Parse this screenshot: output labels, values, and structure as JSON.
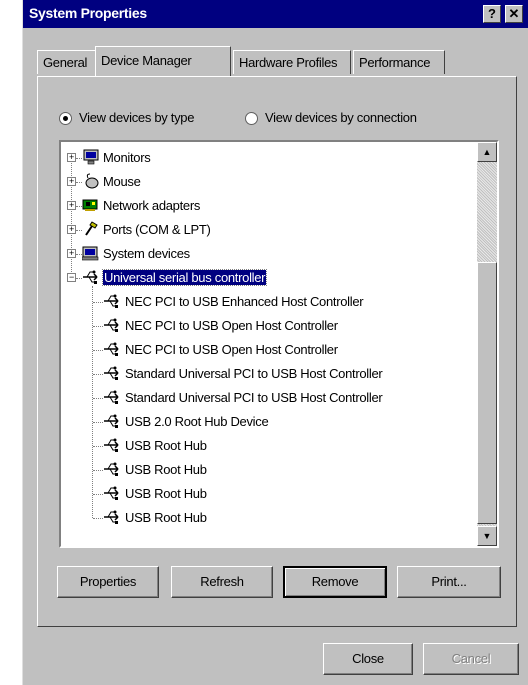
{
  "window": {
    "title": "System Properties",
    "help_glyph": "?",
    "close_glyph": "✕"
  },
  "tabs": [
    {
      "label": "General",
      "active": false
    },
    {
      "label": "Device Manager",
      "active": true
    },
    {
      "label": "Hardware Profiles",
      "active": false
    },
    {
      "label": "Performance",
      "active": false
    }
  ],
  "view": {
    "by_type": {
      "label": "View devices by type",
      "selected": true
    },
    "by_connection": {
      "label": "View devices by connection",
      "selected": false
    }
  },
  "tree": {
    "categories": [
      {
        "label": "Monitors",
        "icon": "monitor-icon",
        "expander": "+"
      },
      {
        "label": "Mouse",
        "icon": "mouse-icon",
        "expander": "+"
      },
      {
        "label": "Network adapters",
        "icon": "network-adapter-icon",
        "expander": "+"
      },
      {
        "label": "Ports (COM & LPT)",
        "icon": "port-icon",
        "expander": "+"
      },
      {
        "label": "System devices",
        "icon": "system-devices-icon",
        "expander": "+"
      },
      {
        "label": "Universal serial bus controller",
        "icon": "usb-icon",
        "expander": "−",
        "selected": true
      }
    ],
    "usb_children": [
      "NEC PCI to USB Enhanced Host Controller",
      "NEC PCI to USB Open Host Controller",
      "NEC PCI to USB Open Host Controller",
      "Standard Universal PCI to USB Host Controller",
      "Standard Universal PCI to USB Host Controller",
      "USB 2.0 Root Hub Device",
      "USB Root Hub",
      "USB Root Hub",
      "USB Root Hub",
      "USB Root Hub"
    ]
  },
  "buttons": {
    "properties": "Properties",
    "refresh": "Refresh",
    "remove": "Remove",
    "print": "Print...",
    "close": "Close",
    "cancel": "Cancel"
  },
  "colors": {
    "titlebar": "#000080",
    "face": "#c0c0c0",
    "selection": "#000080"
  }
}
